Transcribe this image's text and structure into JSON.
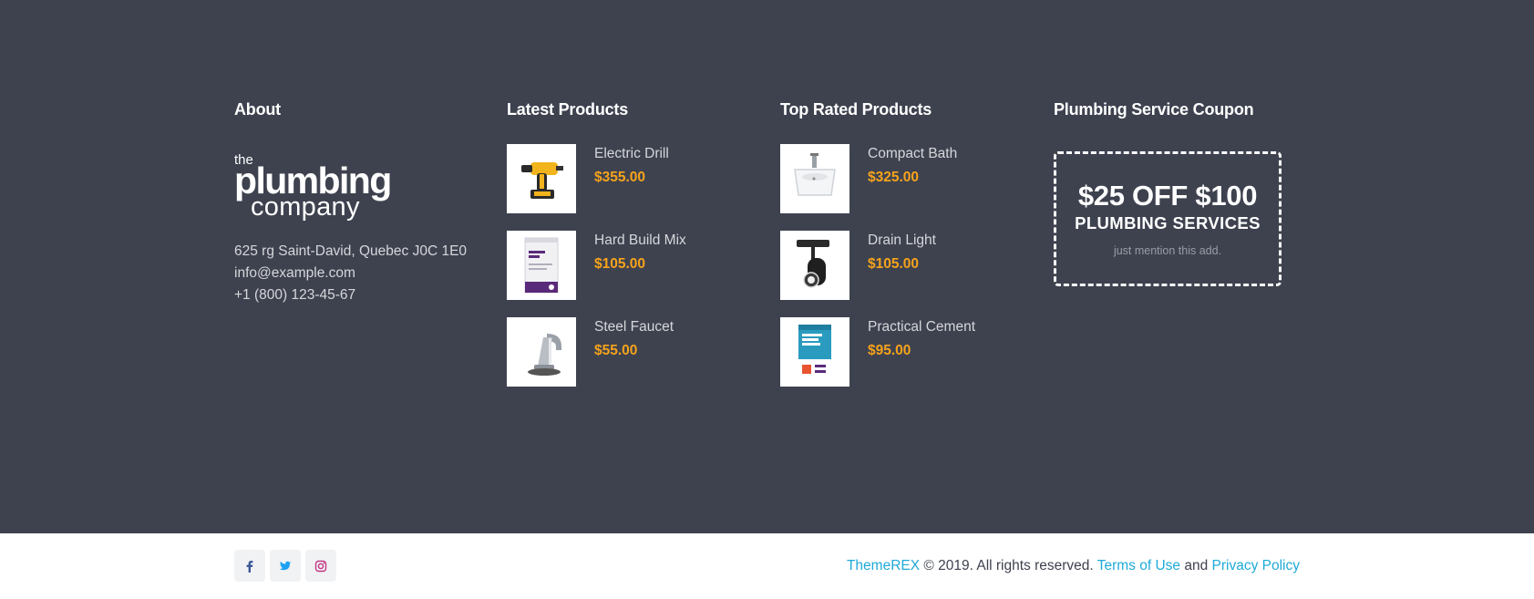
{
  "colors": {
    "footer_bg": "#3e424f",
    "accent_price": "#f6a31b",
    "link": "#1eaad8",
    "facebook": "#3b5998",
    "twitter": "#1da1f2",
    "instagram": "#c13584"
  },
  "about": {
    "title": "About",
    "logo": {
      "the": "the",
      "plumbing": "plumbing",
      "company": "company"
    },
    "address": "625 rg Saint-David, Quebec J0C 1E0",
    "email": "info@example.com",
    "phone": "+1 (800) 123-45-67"
  },
  "latest": {
    "title": "Latest Products",
    "items": [
      {
        "name": "Electric Drill",
        "price": "$355.00",
        "icon": "electric-drill-image"
      },
      {
        "name": "Hard Build Mix",
        "price": "$105.00",
        "icon": "mortar-mix-bag-image"
      },
      {
        "name": "Steel Faucet",
        "price": "$55.00",
        "icon": "steel-faucet-image"
      }
    ]
  },
  "top_rated": {
    "title": "Top Rated Products",
    "items": [
      {
        "name": "Compact Bath",
        "price": "$325.00",
        "icon": "compact-sink-image"
      },
      {
        "name": "Drain Light",
        "price": "$105.00",
        "icon": "track-light-image"
      },
      {
        "name": "Practical Cement",
        "price": "$95.00",
        "icon": "cement-bag-image"
      }
    ]
  },
  "coupon": {
    "title": "Plumbing Service Coupon",
    "headline": "$25 OFF $100",
    "subline": "PLUMBING SERVICES",
    "note": "just mention this add."
  },
  "bottom": {
    "socials": [
      {
        "name": "facebook",
        "icon": "facebook-icon"
      },
      {
        "name": "twitter",
        "icon": "twitter-icon"
      },
      {
        "name": "instagram",
        "icon": "instagram-icon"
      }
    ],
    "brand": "ThemeREX",
    "rights": " © 2019. All rights reserved. ",
    "terms": "Terms of Use",
    "and": " and ",
    "privacy": "Privacy Policy"
  }
}
